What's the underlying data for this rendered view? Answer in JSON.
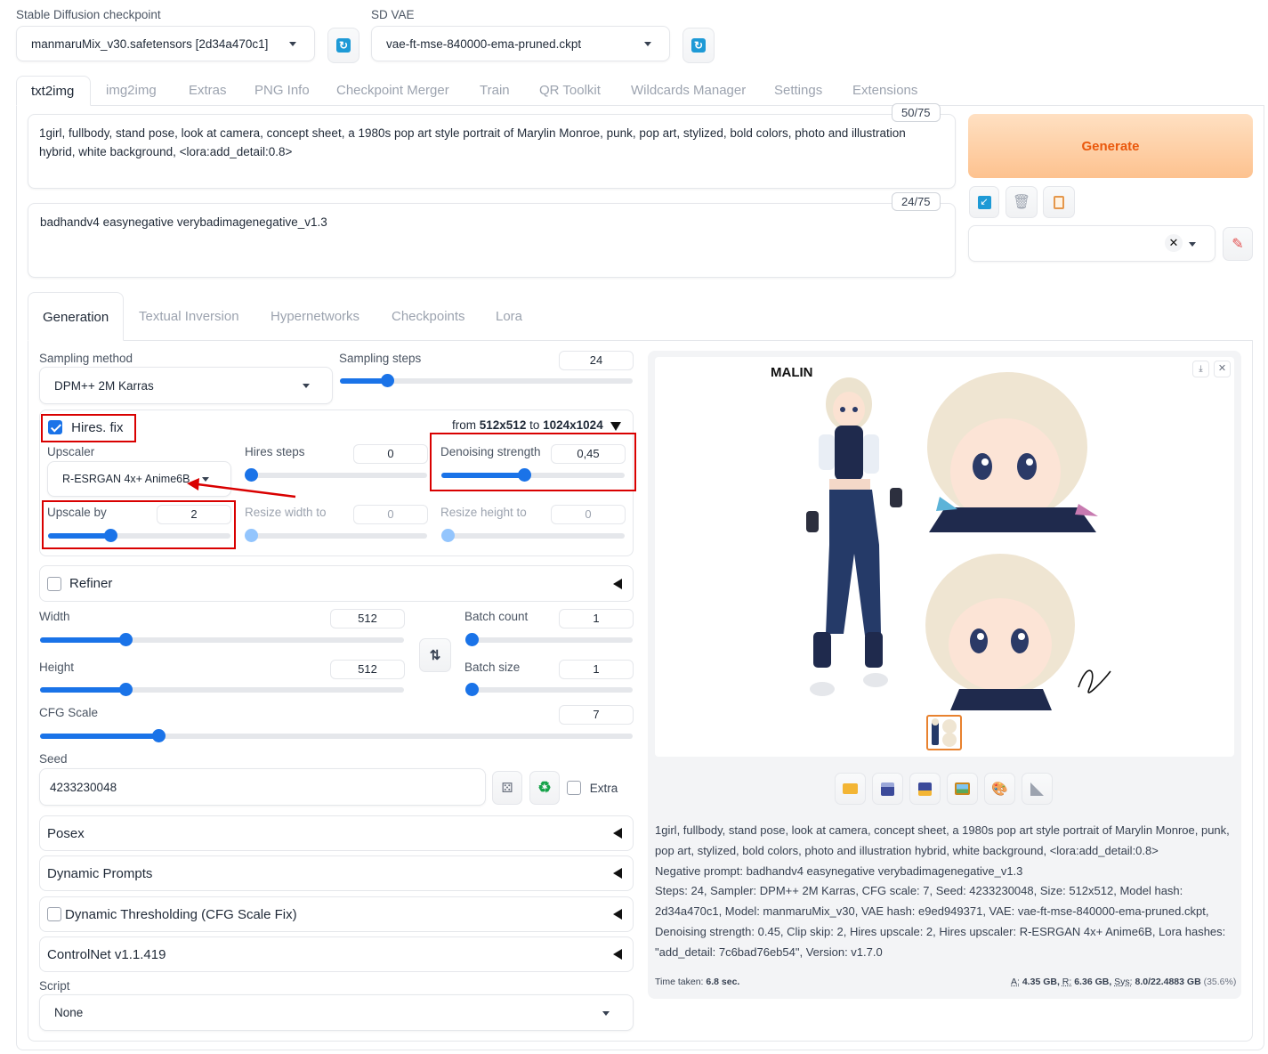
{
  "checkpoint": {
    "label": "Stable Diffusion checkpoint",
    "value": "manmaruMix_v30.safetensors [2d34a470c1]"
  },
  "vae": {
    "label": "SD VAE",
    "value": "vae-ft-mse-840000-ema-pruned.ckpt"
  },
  "main_tabs": [
    "txt2img",
    "img2img",
    "Extras",
    "PNG Info",
    "Checkpoint Merger",
    "Train",
    "QR Toolkit",
    "Wildcards Manager",
    "Settings",
    "Extensions"
  ],
  "prompt": {
    "text": "1girl, fullbody, stand pose, look at camera, concept sheet, a 1980s pop art style portrait of Marylin Monroe, punk, pop art, stylized, bold colors, photo and illustration hybrid, white background, <lora:add_detail:0.8>",
    "counter": "50/75"
  },
  "negative_prompt": {
    "text": "badhandv4 easynegative verybadimagenegative_v1.3",
    "counter": "24/75"
  },
  "generate_label": "Generate",
  "sub_tabs": [
    "Generation",
    "Textual Inversion",
    "Hypernetworks",
    "Checkpoints",
    "Lora"
  ],
  "sampling_method": {
    "label": "Sampling method",
    "value": "DPM++ 2M Karras"
  },
  "sampling_steps": {
    "label": "Sampling steps",
    "value": "24",
    "fraction": 0.16
  },
  "hires": {
    "label": "Hires. fix",
    "from_prefix": "from",
    "from_size": "512x512",
    "to_prefix": "to",
    "to_size": "1024x1024",
    "upscaler": {
      "label": "Upscaler",
      "value": "R-ESRGAN 4x+ Anime6B"
    },
    "hires_steps": {
      "label": "Hires steps",
      "value": "0",
      "fraction": 0.0
    },
    "denoising": {
      "label": "Denoising strength",
      "value": "0,45",
      "fraction": 0.45
    },
    "upscale_by": {
      "label": "Upscale by",
      "value": "2",
      "fraction": 0.34
    },
    "resize_width": {
      "label": "Resize width to",
      "value": "0",
      "fraction": 0.0
    },
    "resize_height": {
      "label": "Resize height to",
      "value": "0",
      "fraction": 0.0
    }
  },
  "refiner_label": "Refiner",
  "width": {
    "label": "Width",
    "value": "512",
    "fraction": 0.235
  },
  "height": {
    "label": "Height",
    "value": "512",
    "fraction": 0.235
  },
  "batch_count": {
    "label": "Batch count",
    "value": "1",
    "fraction": 0.0
  },
  "batch_size": {
    "label": "Batch size",
    "value": "1",
    "fraction": 0.0
  },
  "cfg_scale": {
    "label": "CFG Scale",
    "value": "7",
    "fraction": 0.2
  },
  "seed": {
    "label": "Seed",
    "value": "4233230048",
    "extra_label": "Extra"
  },
  "accordions": [
    "Posex",
    "Dynamic Prompts",
    "Dynamic Thresholding (CFG Scale Fix)",
    "ControlNet v1.1.419"
  ],
  "script": {
    "label": "Script",
    "value": "None"
  },
  "image_logo": "MALIN",
  "info": {
    "line1": "1girl, fullbody, stand pose, look at camera, concept sheet, a 1980s pop art style portrait of Marylin Monroe, punk, pop art, stylized, bold colors, photo and illustration hybrid, white background, <lora:add_detail:0.8>",
    "line2": "Negative prompt: badhandv4 easynegative verybadimagenegative_v1.3",
    "line3": "Steps: 24, Sampler: DPM++ 2M Karras, CFG scale: 7, Seed: 4233230048, Size: 512x512, Model hash: 2d34a470c1, Model: manmaruMix_v30, VAE hash: e9ed949371, VAE: vae-ft-mse-840000-ema-pruned.ckpt, Denoising strength: 0.45, Clip skip: 2, Hires upscale: 2, Hires upscaler: R-ESRGAN 4x+ Anime6B, Lora hashes: \"add_detail: 7c6bad76eb54\", Version: v1.7.0"
  },
  "time_taken": {
    "label": "Time taken:",
    "value": "6.8 sec."
  },
  "memory": {
    "a_label": "A:",
    "a_value": "4.35 GB,",
    "r_label": "R:",
    "r_value": "6.36 GB,",
    "sys_label": "Sys:",
    "sys_value": "8.0/22.4883 GB",
    "sys_pct": "(35.6%)"
  },
  "colors": {
    "accent": "#1a73e8",
    "generate_text": "#ea580c",
    "annotation": "#d90000"
  }
}
